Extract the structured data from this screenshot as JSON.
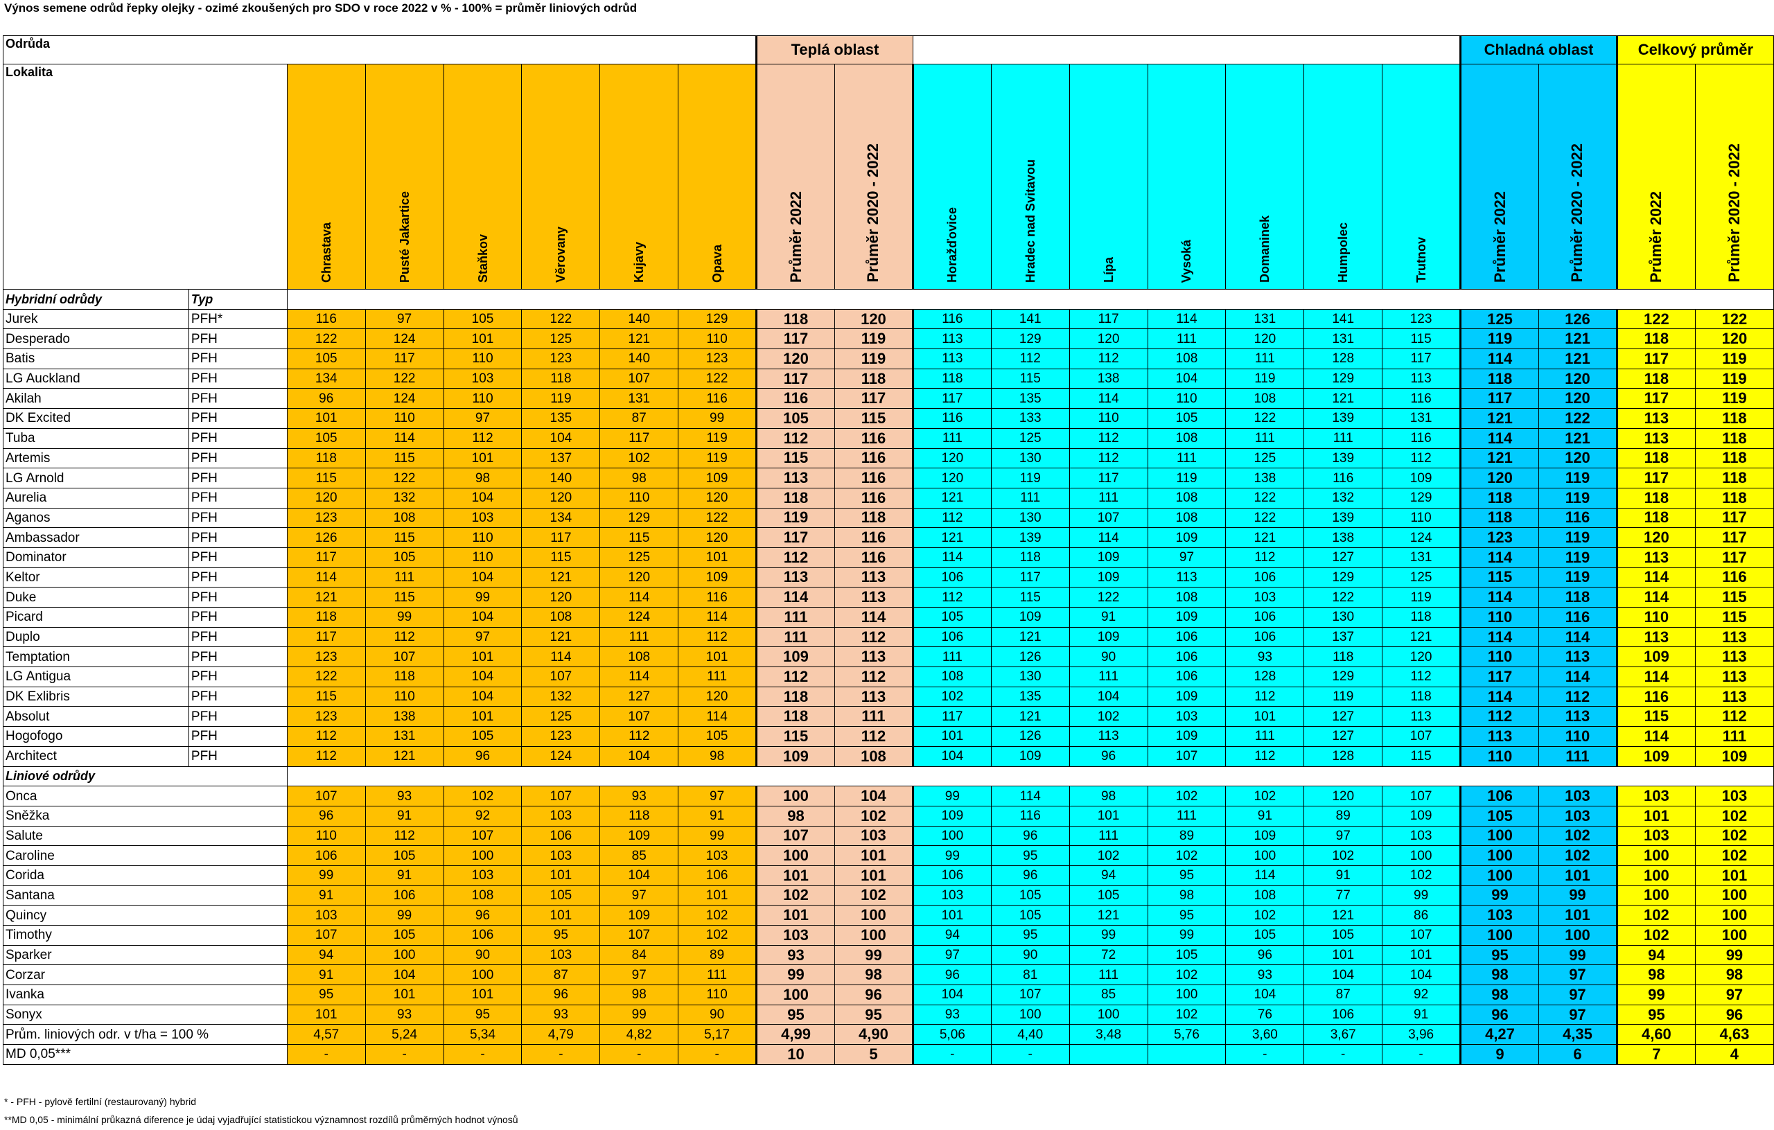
{
  "title": "Výnos semene odrůd řepky olejky - ozimé zkoušených pro SDO v roce 2022 v %  - 100% = průměr liniových odrůd",
  "header": {
    "odruda": "Odrůda",
    "lokalita": "Lokalita",
    "warm": "Teplá oblast",
    "cold": "Chladná oblast",
    "total": "Celkový průměr",
    "columns": [
      "Chrastava",
      "Pusté Jakartice",
      "Staňkov",
      "Věrovany",
      "Kujavy",
      "Opava",
      "Průměr 2022",
      "Průměr 2020 - 2022",
      "Horažďovice",
      "Hradec nad Svitavou",
      "Lípa",
      "Vysoká",
      "Domaninek",
      "Humpolec",
      "Trutnov",
      "Průměr 2022",
      "Průměr 2020 - 2022",
      "Průměr 2022",
      "Průměr 2020 - 2022"
    ]
  },
  "sections": {
    "hybrid": {
      "label": "Hybridní odrůdy",
      "type_label": "Typ"
    },
    "line": {
      "label": "Liniové odrůdy"
    }
  },
  "hybrid_rows": [
    {
      "name": "Jurek",
      "type": "PFH*",
      "values": [
        116,
        97,
        105,
        122,
        140,
        129,
        118,
        120,
        116,
        141,
        117,
        114,
        131,
        141,
        123,
        125,
        126,
        122,
        122
      ]
    },
    {
      "name": "Desperado",
      "type": "PFH",
      "values": [
        122,
        124,
        101,
        125,
        121,
        110,
        117,
        119,
        113,
        129,
        120,
        111,
        120,
        131,
        115,
        119,
        121,
        118,
        120
      ]
    },
    {
      "name": "Batis",
      "type": "PFH",
      "values": [
        105,
        117,
        110,
        123,
        140,
        123,
        120,
        119,
        113,
        112,
        112,
        108,
        111,
        128,
        117,
        114,
        121,
        117,
        119
      ]
    },
    {
      "name": "LG Auckland",
      "type": "PFH",
      "values": [
        134,
        122,
        103,
        118,
        107,
        122,
        117,
        118,
        118,
        115,
        138,
        104,
        119,
        129,
        113,
        118,
        120,
        118,
        119
      ]
    },
    {
      "name": "Akilah",
      "type": "PFH",
      "values": [
        96,
        124,
        110,
        119,
        131,
        116,
        116,
        117,
        117,
        135,
        114,
        110,
        108,
        121,
        116,
        117,
        120,
        117,
        119
      ]
    },
    {
      "name": "DK Excited",
      "type": "PFH",
      "values": [
        101,
        110,
        97,
        135,
        87,
        99,
        105,
        115,
        116,
        133,
        110,
        105,
        122,
        139,
        131,
        121,
        122,
        113,
        118
      ]
    },
    {
      "name": "Tuba",
      "type": "PFH",
      "values": [
        105,
        114,
        112,
        104,
        117,
        119,
        112,
        116,
        111,
        125,
        112,
        108,
        111,
        111,
        116,
        114,
        121,
        113,
        118
      ]
    },
    {
      "name": "Artemis",
      "type": "PFH",
      "values": [
        118,
        115,
        101,
        137,
        102,
        119,
        115,
        116,
        120,
        130,
        112,
        111,
        125,
        139,
        112,
        121,
        120,
        118,
        118
      ]
    },
    {
      "name": "LG Arnold",
      "type": "PFH",
      "values": [
        115,
        122,
        98,
        140,
        98,
        109,
        113,
        116,
        120,
        119,
        117,
        119,
        138,
        116,
        109,
        120,
        119,
        117,
        118
      ]
    },
    {
      "name": "Aurelia",
      "type": "PFH",
      "values": [
        120,
        132,
        104,
        120,
        110,
        120,
        118,
        116,
        121,
        111,
        111,
        108,
        122,
        132,
        129,
        118,
        119,
        118,
        118
      ]
    },
    {
      "name": "Aganos",
      "type": "PFH",
      "values": [
        123,
        108,
        103,
        134,
        129,
        122,
        119,
        118,
        112,
        130,
        107,
        108,
        122,
        139,
        110,
        118,
        116,
        118,
        117
      ]
    },
    {
      "name": "Ambassador",
      "type": "PFH",
      "values": [
        126,
        115,
        110,
        117,
        115,
        120,
        117,
        116,
        121,
        139,
        114,
        109,
        121,
        138,
        124,
        123,
        119,
        120,
        117
      ]
    },
    {
      "name": "Dominator",
      "type": "PFH",
      "values": [
        117,
        105,
        110,
        115,
        125,
        101,
        112,
        116,
        114,
        118,
        109,
        97,
        112,
        127,
        131,
        114,
        119,
        113,
        117
      ]
    },
    {
      "name": "Keltor",
      "type": "PFH",
      "values": [
        114,
        111,
        104,
        121,
        120,
        109,
        113,
        113,
        106,
        117,
        109,
        113,
        106,
        129,
        125,
        115,
        119,
        114,
        116
      ]
    },
    {
      "name": "Duke",
      "type": "PFH",
      "values": [
        121,
        115,
        99,
        120,
        114,
        116,
        114,
        113,
        112,
        115,
        122,
        108,
        103,
        122,
        119,
        114,
        118,
        114,
        115
      ]
    },
    {
      "name": "Picard",
      "type": "PFH",
      "values": [
        118,
        99,
        104,
        108,
        124,
        114,
        111,
        114,
        105,
        109,
        91,
        109,
        106,
        130,
        118,
        110,
        116,
        110,
        115
      ]
    },
    {
      "name": "Duplo",
      "type": "PFH",
      "values": [
        117,
        112,
        97,
        121,
        111,
        112,
        111,
        112,
        106,
        121,
        109,
        106,
        106,
        137,
        121,
        114,
        114,
        113,
        113
      ]
    },
    {
      "name": "Temptation",
      "type": "PFH",
      "values": [
        123,
        107,
        101,
        114,
        108,
        101,
        109,
        113,
        111,
        126,
        90,
        106,
        93,
        118,
        120,
        110,
        113,
        109,
        113
      ]
    },
    {
      "name": "LG Antigua",
      "type": "PFH",
      "values": [
        122,
        118,
        104,
        107,
        114,
        111,
        112,
        112,
        108,
        130,
        111,
        106,
        128,
        129,
        112,
        117,
        114,
        114,
        113
      ]
    },
    {
      "name": "DK Exlibris",
      "type": "PFH",
      "values": [
        115,
        110,
        104,
        132,
        127,
        120,
        118,
        113,
        102,
        135,
        104,
        109,
        112,
        119,
        118,
        114,
        112,
        116,
        113
      ]
    },
    {
      "name": "Absolut",
      "type": "PFH",
      "values": [
        123,
        138,
        101,
        125,
        107,
        114,
        118,
        111,
        117,
        121,
        102,
        103,
        101,
        127,
        113,
        112,
        113,
        115,
        112
      ]
    },
    {
      "name": "Hogofogo",
      "type": "PFH",
      "values": [
        112,
        131,
        105,
        123,
        112,
        105,
        115,
        112,
        101,
        126,
        113,
        109,
        111,
        127,
        107,
        113,
        110,
        114,
        111
      ]
    },
    {
      "name": "Architect",
      "type": "PFH",
      "values": [
        112,
        121,
        96,
        124,
        104,
        98,
        109,
        108,
        104,
        109,
        96,
        107,
        112,
        128,
        115,
        110,
        111,
        109,
        109
      ]
    }
  ],
  "line_rows": [
    {
      "name": "Onca",
      "values": [
        107,
        93,
        102,
        107,
        93,
        97,
        100,
        104,
        99,
        114,
        98,
        102,
        102,
        120,
        107,
        106,
        103,
        103,
        103
      ]
    },
    {
      "name": "Sněžka",
      "values": [
        96,
        91,
        92,
        103,
        118,
        91,
        98,
        102,
        109,
        116,
        101,
        111,
        91,
        89,
        109,
        105,
        103,
        101,
        102
      ]
    },
    {
      "name": "Salute",
      "values": [
        110,
        112,
        107,
        106,
        109,
        99,
        107,
        103,
        100,
        96,
        111,
        89,
        109,
        97,
        103,
        100,
        102,
        103,
        102
      ]
    },
    {
      "name": "Caroline",
      "values": [
        106,
        105,
        100,
        103,
        85,
        103,
        100,
        101,
        99,
        95,
        102,
        102,
        100,
        102,
        100,
        100,
        102,
        100,
        102
      ]
    },
    {
      "name": "Corida",
      "values": [
        99,
        91,
        103,
        101,
        104,
        106,
        101,
        101,
        106,
        96,
        94,
        95,
        114,
        91,
        102,
        100,
        101,
        100,
        101
      ]
    },
    {
      "name": "Santana",
      "values": [
        91,
        106,
        108,
        105,
        97,
        101,
        102,
        102,
        103,
        105,
        105,
        98,
        108,
        77,
        99,
        99,
        99,
        100,
        100
      ]
    },
    {
      "name": "Quincy",
      "values": [
        103,
        99,
        96,
        101,
        109,
        102,
        101,
        100,
        101,
        105,
        121,
        95,
        102,
        121,
        86,
        103,
        101,
        102,
        100
      ]
    },
    {
      "name": "Timothy",
      "values": [
        107,
        105,
        106,
        95,
        107,
        102,
        103,
        100,
        94,
        95,
        99,
        99,
        105,
        105,
        107,
        100,
        100,
        102,
        100
      ]
    },
    {
      "name": "Sparker",
      "values": [
        94,
        100,
        90,
        103,
        84,
        89,
        93,
        99,
        97,
        90,
        72,
        105,
        96,
        101,
        101,
        95,
        99,
        94,
        99
      ]
    },
    {
      "name": "Corzar",
      "values": [
        91,
        104,
        100,
        87,
        97,
        111,
        99,
        98,
        96,
        81,
        111,
        102,
        93,
        104,
        104,
        98,
        97,
        98,
        98
      ]
    },
    {
      "name": "Ivanka",
      "values": [
        95,
        101,
        101,
        96,
        98,
        110,
        100,
        96,
        104,
        107,
        85,
        100,
        104,
        87,
        92,
        98,
        97,
        99,
        97
      ]
    },
    {
      "name": "Sonyx",
      "values": [
        101,
        93,
        95,
        93,
        99,
        90,
        95,
        95,
        93,
        100,
        100,
        102,
        76,
        106,
        91,
        96,
        97,
        95,
        96
      ]
    }
  ],
  "avg_row": {
    "label": "Prům. liniových odr. v t/ha = 100 %",
    "values": [
      "4,57",
      "5,24",
      "5,34",
      "4,79",
      "4,82",
      "5,17",
      "4,99",
      "4,90",
      "5,06",
      "4,40",
      "3,48",
      "5,76",
      "3,60",
      "3,67",
      "3,96",
      "4,27",
      "4,35",
      "4,60",
      "4,63"
    ]
  },
  "md_row": {
    "label": "MD 0,05***",
    "values": [
      "-",
      "-",
      "-",
      "-",
      "-",
      "-",
      "10",
      "5",
      "-",
      "-",
      "",
      "",
      "-",
      "-",
      "-",
      "9",
      "6",
      "7",
      "4"
    ]
  },
  "footnotes": [
    "* - PFH - pylově fertilní (restaurovaný) hybrid",
    "**MD 0,05 - minimální průkazná diference je údaj vyjadřující statistickou významnost rozdílů průměrných hodnot výnosů"
  ],
  "colors": {
    "warm_loc": "#FFC000",
    "warm_avg": "#F8CBAD",
    "cold_loc": "#00FFFF",
    "cold_avg": "#00CCFF",
    "total_avg": "#FFFF00"
  }
}
